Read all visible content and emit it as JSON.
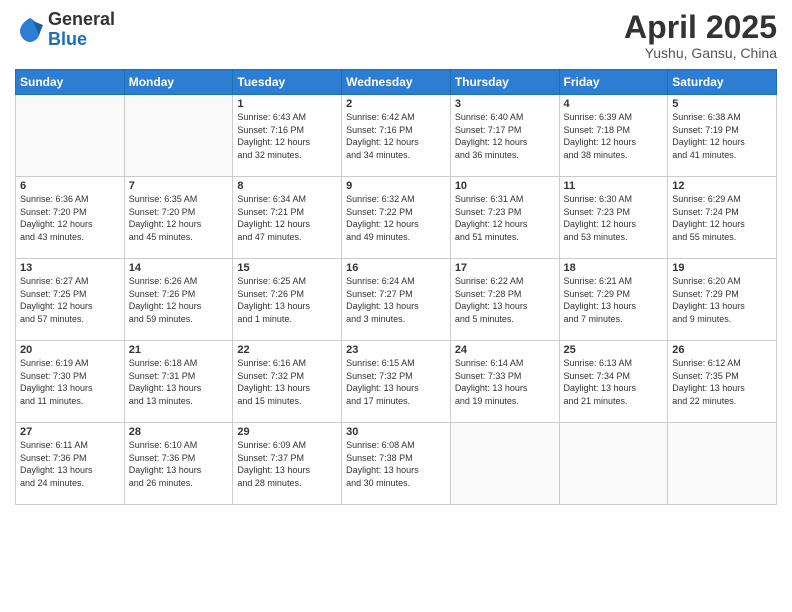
{
  "logo": {
    "general": "General",
    "blue": "Blue"
  },
  "header": {
    "month": "April 2025",
    "location": "Yushu, Gansu, China"
  },
  "weekdays": [
    "Sunday",
    "Monday",
    "Tuesday",
    "Wednesday",
    "Thursday",
    "Friday",
    "Saturday"
  ],
  "weeks": [
    [
      {
        "day": "",
        "detail": ""
      },
      {
        "day": "",
        "detail": ""
      },
      {
        "day": "1",
        "detail": "Sunrise: 6:43 AM\nSunset: 7:16 PM\nDaylight: 12 hours\nand 32 minutes."
      },
      {
        "day": "2",
        "detail": "Sunrise: 6:42 AM\nSunset: 7:16 PM\nDaylight: 12 hours\nand 34 minutes."
      },
      {
        "day": "3",
        "detail": "Sunrise: 6:40 AM\nSunset: 7:17 PM\nDaylight: 12 hours\nand 36 minutes."
      },
      {
        "day": "4",
        "detail": "Sunrise: 6:39 AM\nSunset: 7:18 PM\nDaylight: 12 hours\nand 38 minutes."
      },
      {
        "day": "5",
        "detail": "Sunrise: 6:38 AM\nSunset: 7:19 PM\nDaylight: 12 hours\nand 41 minutes."
      }
    ],
    [
      {
        "day": "6",
        "detail": "Sunrise: 6:36 AM\nSunset: 7:20 PM\nDaylight: 12 hours\nand 43 minutes."
      },
      {
        "day": "7",
        "detail": "Sunrise: 6:35 AM\nSunset: 7:20 PM\nDaylight: 12 hours\nand 45 minutes."
      },
      {
        "day": "8",
        "detail": "Sunrise: 6:34 AM\nSunset: 7:21 PM\nDaylight: 12 hours\nand 47 minutes."
      },
      {
        "day": "9",
        "detail": "Sunrise: 6:32 AM\nSunset: 7:22 PM\nDaylight: 12 hours\nand 49 minutes."
      },
      {
        "day": "10",
        "detail": "Sunrise: 6:31 AM\nSunset: 7:23 PM\nDaylight: 12 hours\nand 51 minutes."
      },
      {
        "day": "11",
        "detail": "Sunrise: 6:30 AM\nSunset: 7:23 PM\nDaylight: 12 hours\nand 53 minutes."
      },
      {
        "day": "12",
        "detail": "Sunrise: 6:29 AM\nSunset: 7:24 PM\nDaylight: 12 hours\nand 55 minutes."
      }
    ],
    [
      {
        "day": "13",
        "detail": "Sunrise: 6:27 AM\nSunset: 7:25 PM\nDaylight: 12 hours\nand 57 minutes."
      },
      {
        "day": "14",
        "detail": "Sunrise: 6:26 AM\nSunset: 7:26 PM\nDaylight: 12 hours\nand 59 minutes."
      },
      {
        "day": "15",
        "detail": "Sunrise: 6:25 AM\nSunset: 7:26 PM\nDaylight: 13 hours\nand 1 minute."
      },
      {
        "day": "16",
        "detail": "Sunrise: 6:24 AM\nSunset: 7:27 PM\nDaylight: 13 hours\nand 3 minutes."
      },
      {
        "day": "17",
        "detail": "Sunrise: 6:22 AM\nSunset: 7:28 PM\nDaylight: 13 hours\nand 5 minutes."
      },
      {
        "day": "18",
        "detail": "Sunrise: 6:21 AM\nSunset: 7:29 PM\nDaylight: 13 hours\nand 7 minutes."
      },
      {
        "day": "19",
        "detail": "Sunrise: 6:20 AM\nSunset: 7:29 PM\nDaylight: 13 hours\nand 9 minutes."
      }
    ],
    [
      {
        "day": "20",
        "detail": "Sunrise: 6:19 AM\nSunset: 7:30 PM\nDaylight: 13 hours\nand 11 minutes."
      },
      {
        "day": "21",
        "detail": "Sunrise: 6:18 AM\nSunset: 7:31 PM\nDaylight: 13 hours\nand 13 minutes."
      },
      {
        "day": "22",
        "detail": "Sunrise: 6:16 AM\nSunset: 7:32 PM\nDaylight: 13 hours\nand 15 minutes."
      },
      {
        "day": "23",
        "detail": "Sunrise: 6:15 AM\nSunset: 7:32 PM\nDaylight: 13 hours\nand 17 minutes."
      },
      {
        "day": "24",
        "detail": "Sunrise: 6:14 AM\nSunset: 7:33 PM\nDaylight: 13 hours\nand 19 minutes."
      },
      {
        "day": "25",
        "detail": "Sunrise: 6:13 AM\nSunset: 7:34 PM\nDaylight: 13 hours\nand 21 minutes."
      },
      {
        "day": "26",
        "detail": "Sunrise: 6:12 AM\nSunset: 7:35 PM\nDaylight: 13 hours\nand 22 minutes."
      }
    ],
    [
      {
        "day": "27",
        "detail": "Sunrise: 6:11 AM\nSunset: 7:36 PM\nDaylight: 13 hours\nand 24 minutes."
      },
      {
        "day": "28",
        "detail": "Sunrise: 6:10 AM\nSunset: 7:36 PM\nDaylight: 13 hours\nand 26 minutes."
      },
      {
        "day": "29",
        "detail": "Sunrise: 6:09 AM\nSunset: 7:37 PM\nDaylight: 13 hours\nand 28 minutes."
      },
      {
        "day": "30",
        "detail": "Sunrise: 6:08 AM\nSunset: 7:38 PM\nDaylight: 13 hours\nand 30 minutes."
      },
      {
        "day": "",
        "detail": ""
      },
      {
        "day": "",
        "detail": ""
      },
      {
        "day": "",
        "detail": ""
      }
    ]
  ]
}
